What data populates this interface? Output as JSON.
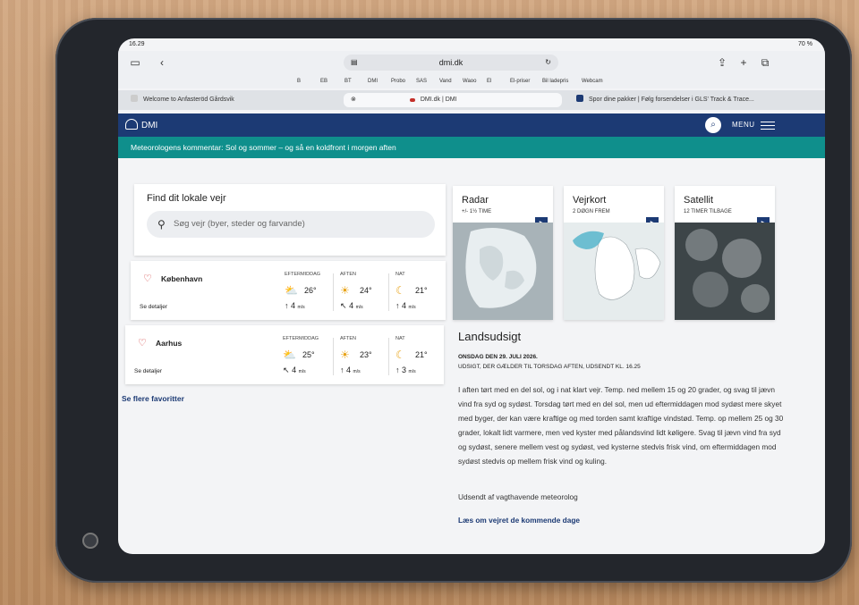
{
  "status": {
    "time": "16.29",
    "battery": "70 %"
  },
  "browser": {
    "url": "dmi.dk",
    "bookmarks": [
      "B",
      "EB",
      "BT",
      "DMI",
      "Probo",
      "SAS",
      "Vand",
      "Waoo",
      "El",
      "El-priser",
      "Bil ladepris",
      "Webcam"
    ],
    "tabs": [
      {
        "title": "Welcome to Anfasteröd Gårdsvik",
        "active": false
      },
      {
        "title": "DMI.dk | DMI",
        "active": true
      },
      {
        "title": "Spor dine pakker | Følg forsendelser i GLS' Track & Trace...",
        "active": false
      }
    ]
  },
  "dmi": {
    "logo": "DMI",
    "menu_label": "MENU",
    "banner": "Meteorologens kommentar: Sol og sommer – og så en koldfront i morgen aften",
    "find": {
      "title": "Find dit lokale vejr",
      "placeholder": "Søg vejr (byer, steder og farvande)"
    },
    "favorites": [
      {
        "city": "København",
        "details": "Se detaljer",
        "slots": [
          {
            "label": "EFTERMIDDAG",
            "icon": "partly-cloudy-icon",
            "temp": "26°",
            "wind_dir": "↑",
            "wind": "4",
            "unit": "m/s"
          },
          {
            "label": "AFTEN",
            "icon": "sun-icon",
            "temp": "24°",
            "wind_dir": "↖",
            "wind": "4",
            "unit": "m/s"
          },
          {
            "label": "NAT",
            "icon": "moon-icon",
            "temp": "21°",
            "wind_dir": "↑",
            "wind": "4",
            "unit": "m/s"
          }
        ]
      },
      {
        "city": "Aarhus",
        "details": "Se detaljer",
        "slots": [
          {
            "label": "EFTERMIDDAG",
            "icon": "partly-cloudy-icon",
            "temp": "25°",
            "wind_dir": "↖",
            "wind": "4",
            "unit": "m/s"
          },
          {
            "label": "AFTEN",
            "icon": "sun-icon",
            "temp": "23°",
            "wind_dir": "↑",
            "wind": "4",
            "unit": "m/s"
          },
          {
            "label": "NAT",
            "icon": "moon-icon",
            "temp": "21°",
            "wind_dir": "↑",
            "wind": "3",
            "unit": "m/s"
          }
        ]
      }
    ],
    "more_favorites": "Se flere favoritter",
    "tiles": [
      {
        "title": "Radar",
        "sub": "+/- 1½ TIME"
      },
      {
        "title": "Vejrkort",
        "sub": "2 DØGN FREM"
      },
      {
        "title": "Satellit",
        "sub": "12 TIMER TILBAGE"
      }
    ],
    "forecast": {
      "heading": "Landsudsigt",
      "date": "ONSDAG DEN 29. JULI 2026.",
      "valid": "UDSIGT, DER GÆLDER TIL TORSDAG AFTEN, UDSENDT KL. 16.25",
      "body": "I aften tørt med en del sol, og i nat klart vejr. Temp. ned mellem 15 og 20 grader, og svag til jævn vind fra syd og sydøst. Torsdag tørt med en del sol, men ud eftermiddagen mod sydøst mere skyet med byger, der kan være kraftige og med torden samt kraftige vindstød. Temp. op mellem 25 og 30 grader, lokalt lidt varmere, men ved kyster med pålandsvind lidt køligere. Svag til jævn vind fra syd og sydøst, senere mellem vest og sydøst, ved kysterne stedvis frisk vind, om eftermiddagen mod sydøst stedvis op mellem frisk vind og kuling.",
      "sender": "Udsendt af vagthavende meteorolog",
      "link": "Læs om vejret de kommende dage"
    }
  }
}
